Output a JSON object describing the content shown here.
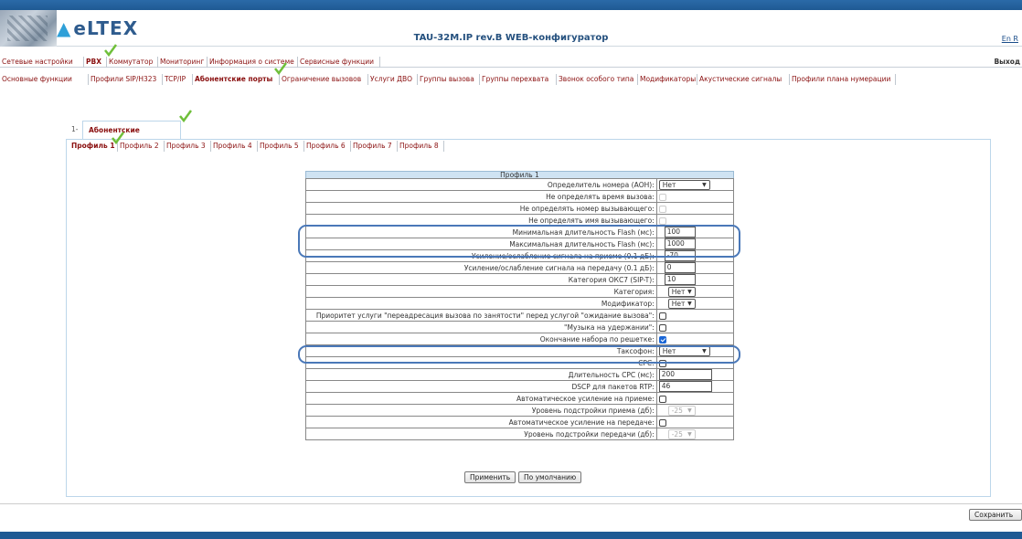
{
  "header": {
    "logo_text": "eLTEX",
    "title": "TAU-32M.IP rev.B WEB-конфигуратор",
    "lang": "En R"
  },
  "main_menu": [
    "Сетевые настройки",
    "PBX",
    "Коммутатор",
    "Мониторинг",
    "Информация о системе",
    "Сервисные функции"
  ],
  "logout": "Выход",
  "sub_menu": [
    "Основные функции",
    "Профили SIP/H323",
    "TCP/IP",
    "Абонентские порты",
    "Ограничение вызовов",
    "Услуги ДВО",
    "Группы вызова",
    "Группы перехвата",
    "Звонок особого типа",
    "Модификаторы",
    "Акустические сигналы",
    "Профили плана нумерации"
  ],
  "tabs": {
    "first": "1-",
    "second": "Абонентские профили"
  },
  "profiles": [
    "Профиль 1",
    "Профиль 2",
    "Профиль 3",
    "Профиль 4",
    "Профиль 5",
    "Профиль 6",
    "Профиль 7",
    "Профиль 8"
  ],
  "table": {
    "caption": "Профиль 1",
    "rows": {
      "aon": {
        "label": "Определитель номера (АОН):",
        "value": "Нет"
      },
      "no_time": {
        "label": "Не определять время вызова:"
      },
      "no_number": {
        "label": "Не определять номер вызывающего:"
      },
      "no_name": {
        "label": "Не определять имя вызывающего:"
      },
      "flash_min": {
        "label": "Минимальная длительность Flash (мс):",
        "value": "100"
      },
      "flash_max": {
        "label": "Максимальная длительность Flash (мс):",
        "value": "1000"
      },
      "gain_rx": {
        "label": "Усиление/ослабление сигнала на приеме (0.1 дБ):",
        "value": "-70"
      },
      "gain_tx": {
        "label": "Усиление/ослабление сигнала на передачу (0.1 дБ):",
        "value": "0"
      },
      "oks7": {
        "label": "Категория ОКС7 (SIP-T):",
        "value": "10"
      },
      "category": {
        "label": "Категория:",
        "value": "Нет"
      },
      "modifier": {
        "label": "Модификатор:",
        "value": "Нет"
      },
      "priority": {
        "label": "Приоритет услуги \"переадресация вызова по занятости\" перед услугой \"ожидание вызова\":"
      },
      "moh": {
        "label": "\"Музыка на удержании\":"
      },
      "hash_end": {
        "label": "Окончание набора по решетке:"
      },
      "payphone": {
        "label": "Таксофон:",
        "value": "Нет"
      },
      "cpc": {
        "label": "CPC:"
      },
      "cpc_dur": {
        "label": "Длительность CPC (мс):",
        "value": "200"
      },
      "dscp": {
        "label": "DSCP для пакетов RTP:",
        "value": "46"
      },
      "agc_rx": {
        "label": "Автоматическое усиление на приеме:"
      },
      "agc_rx_lvl": {
        "label": "Уровень подстройки приема (дб):",
        "value": "-25"
      },
      "agc_tx": {
        "label": "Автоматическое усиление на передаче:"
      },
      "agc_tx_lvl": {
        "label": "Уровень подстройки передачи (дб):",
        "value": "-25"
      }
    }
  },
  "buttons": {
    "apply": "Применить",
    "default": "По умолчанию",
    "save": "Сохранить"
  },
  "colors": {
    "accent": "#8a1010",
    "brand": "#1f5a93",
    "highlight": "#4a78b8",
    "check_mark": "#6fbf3a"
  }
}
